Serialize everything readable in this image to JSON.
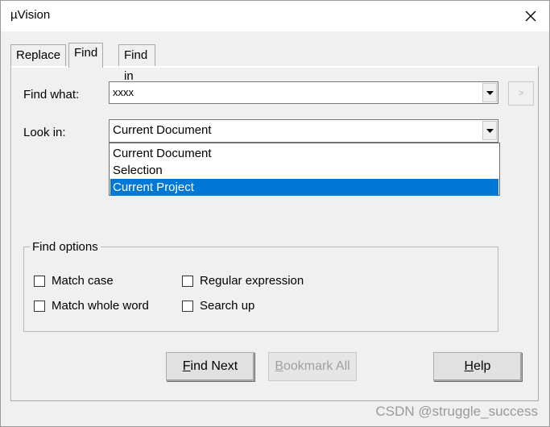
{
  "window": {
    "title": "µVision"
  },
  "tabs": [
    {
      "label": "Replace",
      "active": false
    },
    {
      "label": "Find",
      "active": true
    },
    {
      "label": "Find in Files",
      "active": false
    }
  ],
  "find_what": {
    "label": "Find what:",
    "value": "xxxx"
  },
  "small_button": {
    "label": ">"
  },
  "look_in": {
    "label": "Look in:",
    "value": "Current Document",
    "options": [
      "Current Document",
      "Selection",
      "Current Project"
    ],
    "highlighted": "Current Project"
  },
  "find_options": {
    "title": "Find options",
    "match_case": "Match case",
    "match_whole_word": "Match whole word",
    "regular_expression": "Regular expression",
    "search_up": "Search up"
  },
  "buttons": {
    "find_next_first": "F",
    "find_next_rest": "ind Next",
    "bookmark_first": "B",
    "bookmark_rest": "ookmark All",
    "help_first": "H",
    "help_rest": "elp"
  },
  "watermark": "CSDN @struggle_success",
  "colors": {
    "selection": "#0078d7",
    "background": "#f0f0f0"
  }
}
